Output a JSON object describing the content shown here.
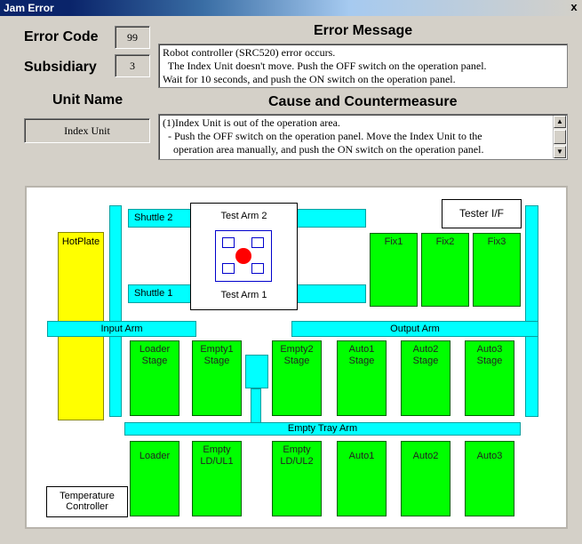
{
  "window": {
    "title": "Jam Error",
    "close_label": "x"
  },
  "error_code": {
    "label": "Error Code",
    "value": "99"
  },
  "subsidiary": {
    "label": "Subsidiary",
    "value": "3"
  },
  "unit_name": {
    "label": "Unit Name",
    "value": "Index Unit"
  },
  "error_message": {
    "label": "Error Message",
    "lines": [
      "Robot controller (SRC520) error occurs.",
      "  The Index Unit doesn't move. Push the OFF switch on the operation panel.",
      "Wait for 10 seconds, and push the ON switch on the operation panel."
    ]
  },
  "cause": {
    "label": "Cause and Countermeasure",
    "lines": [
      "(1)Index Unit is out of the operation area.",
      "  - Push the OFF switch on the operation panel. Move the Index Unit to the",
      "    operation area manually, and push the ON switch on the operation panel."
    ]
  },
  "diagram": {
    "hot_plate": "HotPlate",
    "shuttle1": "Shuttle 1",
    "shuttle2": "Shuttle 2",
    "test_arm1": "Test Arm 1",
    "test_arm2": "Test Arm 2",
    "tester_if": "Tester I/F",
    "fix1": "Fix1",
    "fix2": "Fix2",
    "fix3": "Fix3",
    "input_arm": "Input Arm",
    "output_arm": "Output Arm",
    "stages": [
      {
        "line1": "Loader",
        "line2": "Stage"
      },
      {
        "line1": "Empty1",
        "line2": "Stage"
      },
      {
        "line1": "Empty2",
        "line2": "Stage"
      },
      {
        "line1": "Auto1",
        "line2": "Stage"
      },
      {
        "line1": "Auto2",
        "line2": "Stage"
      },
      {
        "line1": "Auto3",
        "line2": "Stage"
      }
    ],
    "empty_tray_arm": "Empty Tray Arm",
    "bottom": [
      {
        "line1": "Loader",
        "line2": ""
      },
      {
        "line1": "Empty",
        "line2": "LD/UL1"
      },
      {
        "line1": "Empty",
        "line2": "LD/UL2"
      },
      {
        "line1": "Auto1",
        "line2": ""
      },
      {
        "line1": "Auto2",
        "line2": ""
      },
      {
        "line1": "Auto3",
        "line2": ""
      }
    ],
    "temp_ctrl_line1": "Temperature",
    "temp_ctrl_line2": "Controller"
  },
  "colors": {
    "green": "#00ff00",
    "cyan": "#00ffff",
    "yellow": "#ffff00",
    "red": "#ff0000",
    "blue": "#0000cc"
  }
}
